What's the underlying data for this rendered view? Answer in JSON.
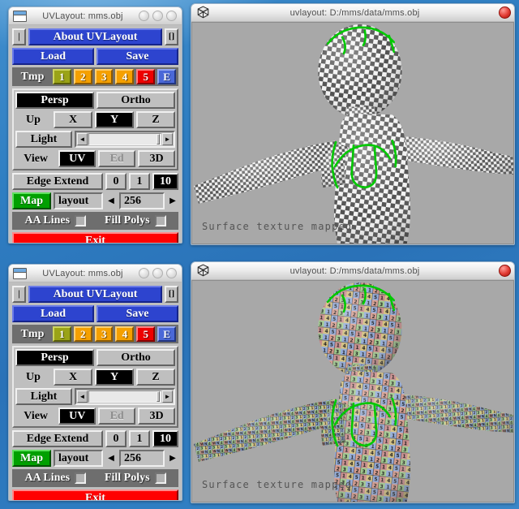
{
  "desktop": {
    "background_color": "#2f7ec2"
  },
  "windows": [
    {
      "id": "top",
      "control_panel": {
        "title": "UVLayout: mms.obj",
        "doc_icon": "document-icon",
        "window_buttons": [
          "minimize-circle",
          "maximize-circle",
          "close-circle"
        ],
        "about_row": {
          "left_btn": "|",
          "about_label": "About UVLayout",
          "right_btn": "[]"
        },
        "file_row": {
          "load": "Load",
          "save": "Save"
        },
        "tmp_row": {
          "label": "Tmp",
          "slots": [
            {
              "label": "1",
              "color": "#9aa317"
            },
            {
              "label": "2",
              "color": "#f5a000"
            },
            {
              "label": "3",
              "color": "#f5a000"
            },
            {
              "label": "4",
              "color": "#f5a000"
            },
            {
              "label": "5",
              "color": "#ee0000"
            },
            {
              "label": "E",
              "color": "#4a68d8"
            }
          ]
        },
        "projection_row": {
          "persp": "Persp",
          "ortho": "Ortho",
          "selected": "Persp"
        },
        "up_row": {
          "label": "Up",
          "axes": [
            "X",
            "Y",
            "Z"
          ],
          "selected": "Y"
        },
        "light_row": {
          "label": "Light",
          "slider_value": 96
        },
        "view_row": {
          "label": "View",
          "modes": [
            "UV",
            "Ed",
            "3D"
          ],
          "selected": "UV",
          "disabled": [
            "Ed"
          ]
        },
        "edge_extend_row": {
          "label": "Edge Extend",
          "options": [
            "0",
            "1",
            "10"
          ],
          "selected": "10"
        },
        "map_row": {
          "map_button": "Map",
          "map_name": "layout",
          "resolution": "256",
          "prev_arrow": "◀",
          "next_arrow": "▶"
        },
        "checkbox_row": {
          "aa_lines_label": "AA Lines",
          "aa_lines_checked": false,
          "fill_polys_label": "Fill Polys",
          "fill_polys_checked": false
        },
        "exit_button": "Exit"
      },
      "viewport": {
        "title": "uvlayout: D:/mms/data/mms.obj",
        "app_icon": "cube-icon",
        "close_button": "close-red-circle",
        "status_text": "Surface texture mapped",
        "texture_style": "checker",
        "background_color": "#a8a8a8",
        "seam_color": "#00c800"
      }
    },
    {
      "id": "bottom",
      "control_panel": {
        "title": "UVLayout: mms.obj",
        "doc_icon": "document-icon",
        "window_buttons": [
          "minimize-circle",
          "maximize-circle",
          "close-circle"
        ],
        "about_row": {
          "left_btn": "|",
          "about_label": "About UVLayout",
          "right_btn": "[]"
        },
        "file_row": {
          "load": "Load",
          "save": "Save"
        },
        "tmp_row": {
          "label": "Tmp",
          "slots": [
            {
              "label": "1",
              "color": "#9aa317"
            },
            {
              "label": "2",
              "color": "#f5a000"
            },
            {
              "label": "3",
              "color": "#f5a000"
            },
            {
              "label": "4",
              "color": "#f5a000"
            },
            {
              "label": "5",
              "color": "#ee0000"
            },
            {
              "label": "E",
              "color": "#4a68d8"
            }
          ]
        },
        "projection_row": {
          "persp": "Persp",
          "ortho": "Ortho",
          "selected": "Persp"
        },
        "up_row": {
          "label": "Up",
          "axes": [
            "X",
            "Y",
            "Z"
          ],
          "selected": "Y"
        },
        "light_row": {
          "label": "Light",
          "slider_value": 96
        },
        "view_row": {
          "label": "View",
          "modes": [
            "UV",
            "Ed",
            "3D"
          ],
          "selected": "UV",
          "disabled": [
            "Ed"
          ]
        },
        "edge_extend_row": {
          "label": "Edge Extend",
          "options": [
            "0",
            "1",
            "10"
          ],
          "selected": "10"
        },
        "map_row": {
          "map_button": "Map",
          "map_name": "layout",
          "resolution": "256",
          "prev_arrow": "◀",
          "next_arrow": "▶"
        },
        "checkbox_row": {
          "aa_lines_label": "AA Lines",
          "aa_lines_checked": false,
          "fill_polys_label": "Fill Polys",
          "fill_polys_checked": false
        },
        "exit_button": "Exit"
      },
      "viewport": {
        "title": "uvlayout: D:/mms/data/mms.obj",
        "app_icon": "cube-icon",
        "close_button": "close-red-circle",
        "status_text": "Surface texture mapped",
        "texture_style": "color-number-grid",
        "background_color": "#a8a8a8",
        "seam_color": "#00c800"
      }
    }
  ]
}
